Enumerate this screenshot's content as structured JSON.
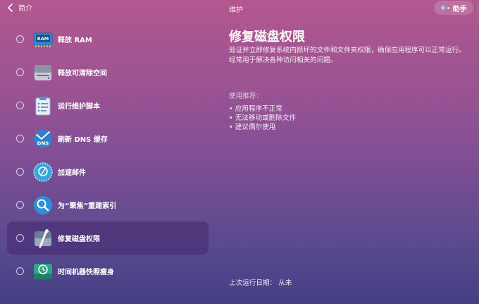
{
  "header": {
    "back_label": "简介",
    "section_title": "维护",
    "assistant_label": "助手"
  },
  "tasks": [
    {
      "label": "释放 RAM",
      "icon": "ram-icon",
      "icon_text": "RAM"
    },
    {
      "label": "释放可清除空间",
      "icon": "drive-icon"
    },
    {
      "label": "运行维护脚本",
      "icon": "clipboard-script-icon"
    },
    {
      "label": "刷新 DNS 缓存",
      "icon": "dns-icon",
      "icon_text": "DNS"
    },
    {
      "label": "加速邮件",
      "icon": "mail-stamp-icon"
    },
    {
      "label": "为“聚焦”重建索引",
      "icon": "spotlight-icon"
    },
    {
      "label": "修复磁盘权限",
      "icon": "wrench-disk-icon",
      "selected": true
    },
    {
      "label": "时间机器快照瘦身",
      "icon": "time-machine-icon"
    }
  ],
  "detail": {
    "title": "修复磁盘权限",
    "description": "验证并立即修复系统内损坏的文件和文件夹权限，确保应用程序可以正常运行。经常用于解决各种访问相关的问题。",
    "recommend_title": "使用推荐：",
    "recommendations": [
      "应用程序不正常",
      "无法移动或删除文件",
      "建议偶尔使用"
    ],
    "last_run": "上次运行日期：  从未"
  },
  "colors": {
    "accent_dot": "#8fd3ff",
    "selected_row": "#46286e"
  }
}
